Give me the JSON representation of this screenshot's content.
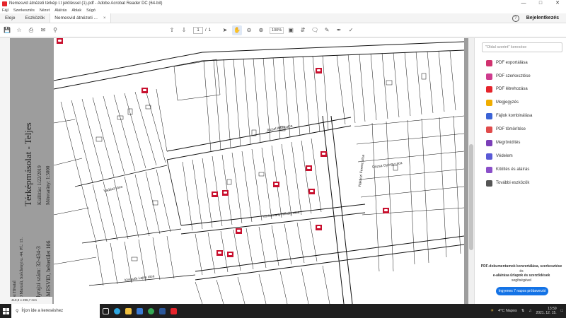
{
  "window": {
    "title": "Nemesvid átnézeti térkép I.t jelöléssel (1).pdf - Adobe Acrobat Reader DC (64-bit)"
  },
  "menu": [
    "Fájl",
    "Szerkesztés",
    "Nézet",
    "Aláírás",
    "Ablak",
    "Súgó"
  ],
  "tabs": {
    "home": "Eleje",
    "tools": "Eszközök",
    "document": "Nemesvid átnézeti ...",
    "close": "×"
  },
  "header": {
    "help": "?",
    "signin": "Bejelentkezés"
  },
  "toolbar": {
    "page_current": "1",
    "page_separator": "/",
    "page_total": "1",
    "zoom": "100%"
  },
  "map": {
    "title": "Térképmásolat - Teljes",
    "issue_date": "Kiállítás: 1/22/2019",
    "scale": "Méretarány: 1:3000",
    "office": "Járási Hivatal",
    "address": "8700 Marcali, Széchenyi u. 44. Pf.: 15.",
    "parcel": "Helyrajzi szám: 32-434-3",
    "district": "NEMESVID, belterület 106",
    "streets": [
      "József Attila utca",
      "Vadász utca",
      "Vörösmarty Mihály utca",
      "Kossuth Lajos utca",
      "Dózsa György utca",
      "Rákóczi Ferenc utca"
    ]
  },
  "panel": {
    "search_placeholder": "\"Oldal szerint\" keresése",
    "tools": [
      {
        "label": "PDF exportálása",
        "color": "#d1326f"
      },
      {
        "label": "PDF szerkesztése",
        "color": "#ce3c8e"
      },
      {
        "label": "PDF létrehozása",
        "color": "#e5242b"
      },
      {
        "label": "Megjegyzés",
        "color": "#f0ad00"
      },
      {
        "label": "Fájlok kombinálása",
        "color": "#3b63d6"
      },
      {
        "label": "PDF tömörítése",
        "color": "#e04b4b"
      },
      {
        "label": "Megrövidítés",
        "color": "#7b3fb8"
      },
      {
        "label": "Védelem",
        "color": "#5a5ad6"
      },
      {
        "label": "Kitöltés és aláírás",
        "color": "#8a4fc9"
      },
      {
        "label": "További eszközök",
        "color": "#555555"
      }
    ],
    "promo_line1": "PDF-dokumentumok konvertálása, szerkesztése",
    "promo_line2": "és",
    "promo_line3": "e-aláírása űrlapok és szerződések",
    "promo_line4": "segítségével",
    "trial_button": "Ingyenes 7 napos próbaverzió"
  },
  "status": {
    "page_size": "419,9 x 296,7 mm"
  },
  "taskbar": {
    "search": "Írjon ide a kereséshez",
    "weather": "4°C  Napos",
    "time": "13:59",
    "date": "2021. 12. 15."
  }
}
